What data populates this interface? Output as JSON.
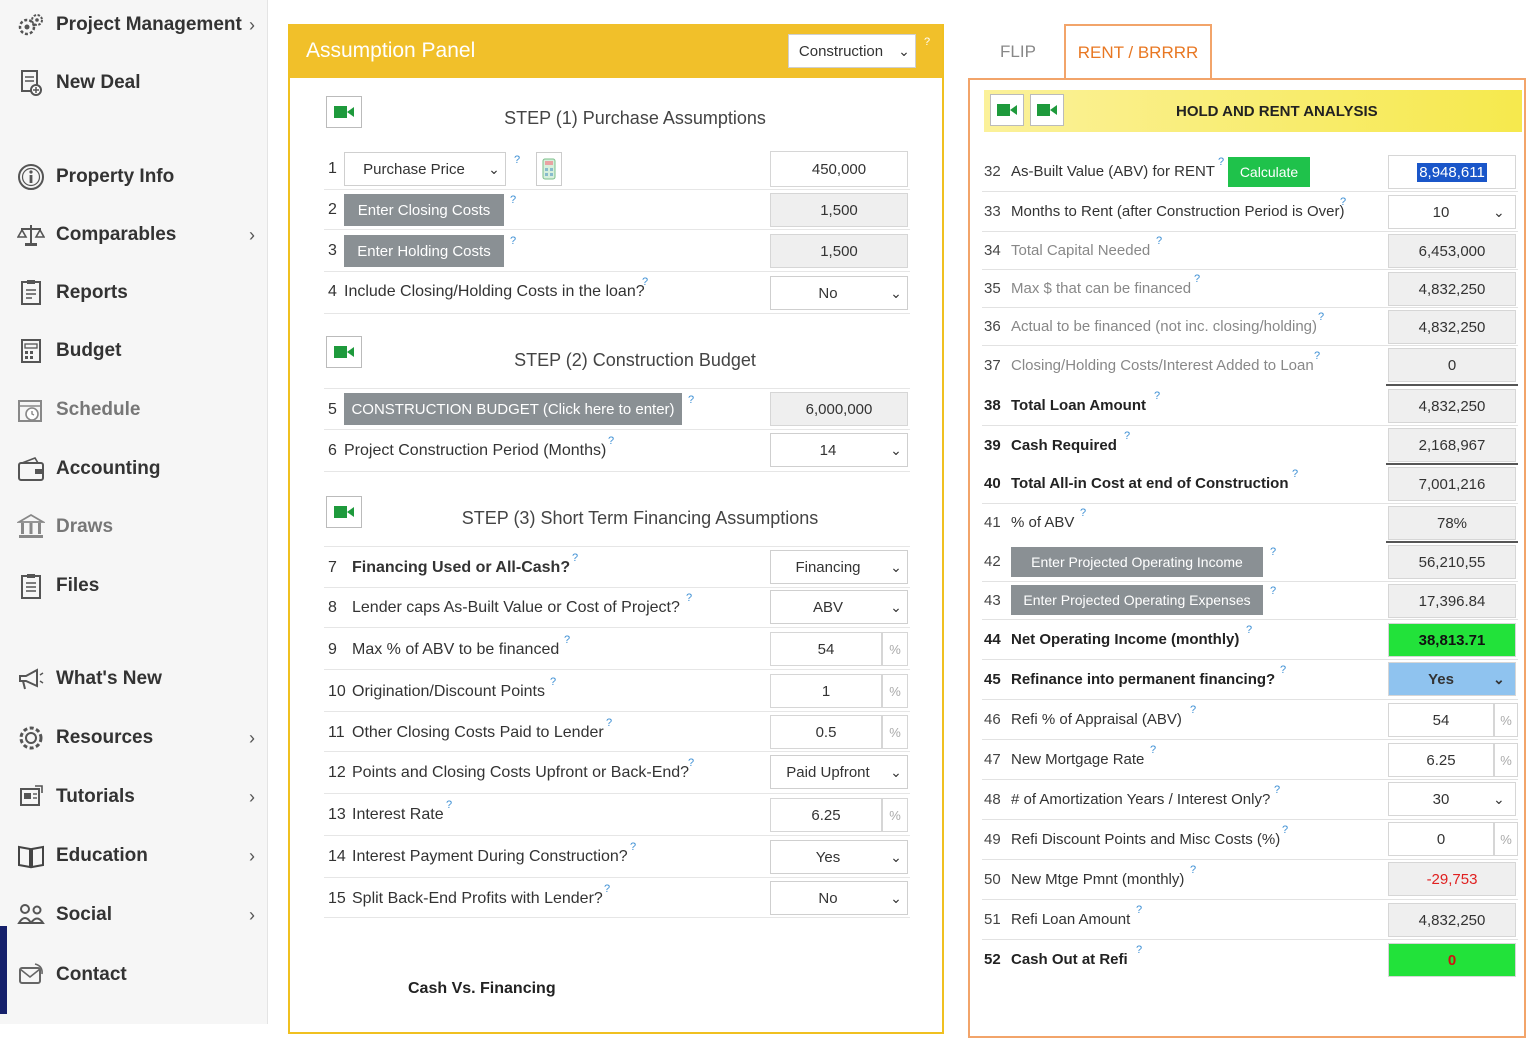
{
  "sidebar": {
    "items": [
      {
        "label": "Project Management",
        "icon": "gears-icon",
        "chevron": true
      },
      {
        "label": "New Deal",
        "icon": "new-document-icon",
        "chevron": false
      },
      {
        "label": "Property Info",
        "icon": "info-icon",
        "chevron": false
      },
      {
        "label": "Comparables",
        "icon": "scales-icon",
        "chevron": true
      },
      {
        "label": "Reports",
        "icon": "report-icon",
        "chevron": false
      },
      {
        "label": "Budget",
        "icon": "budget-icon",
        "chevron": false
      },
      {
        "label": "Schedule",
        "icon": "calendar-clock-icon",
        "chevron": false
      },
      {
        "label": "Accounting",
        "icon": "wallet-icon",
        "chevron": false
      },
      {
        "label": "Draws",
        "icon": "bank-icon",
        "chevron": false
      },
      {
        "label": "Files",
        "icon": "clipboard-icon",
        "chevron": false
      },
      {
        "label": "What's New",
        "icon": "megaphone-icon",
        "chevron": false
      },
      {
        "label": "Resources",
        "icon": "gear-icon",
        "chevron": true
      },
      {
        "label": "Tutorials",
        "icon": "tutorial-icon",
        "chevron": true
      },
      {
        "label": "Education",
        "icon": "book-icon",
        "chevron": true
      },
      {
        "label": "Social",
        "icon": "social-icon",
        "chevron": true
      },
      {
        "label": "Contact",
        "icon": "contact-icon",
        "chevron": false
      }
    ]
  },
  "assumption": {
    "title": "Assumption Panel",
    "mode": "Construction",
    "help": "?",
    "step1_title": "STEP (1) Purchase Assumptions",
    "step2_title": "STEP (2) Construction Budget",
    "step3_title": "STEP (3) Short Term Financing Assumptions",
    "rows": [
      {
        "num": "1",
        "select": "Purchase Price",
        "value": "450,000"
      },
      {
        "num": "2",
        "button": "Enter Closing Costs",
        "value": "1,500"
      },
      {
        "num": "3",
        "button": "Enter Holding Costs",
        "value": "1,500"
      },
      {
        "num": "4",
        "label": "Include Closing/Holding Costs in the loan?",
        "value": "No"
      },
      {
        "num": "5",
        "button": "CONSTRUCTION BUDGET (Click here to enter)",
        "value": "6,000,000"
      },
      {
        "num": "6",
        "label": "Project Construction Period (Months)",
        "value": "14"
      },
      {
        "num": "7",
        "label": "Financing Used or All-Cash?",
        "value": "Financing"
      },
      {
        "num": "8",
        "label": "Lender caps As-Built Value or Cost of Project?",
        "value": "ABV"
      },
      {
        "num": "9",
        "label": "Max % of ABV to be financed",
        "value": "54"
      },
      {
        "num": "10",
        "label": "Origination/Discount Points",
        "value": "1"
      },
      {
        "num": "11",
        "label": "Other Closing Costs Paid to Lender",
        "value": "0.5"
      },
      {
        "num": "12",
        "label": "Points and Closing Costs Upfront or Back-End?",
        "value": "Paid Upfront"
      },
      {
        "num": "13",
        "label": "Interest Rate",
        "value": "6.25"
      },
      {
        "num": "14",
        "label": "Interest Payment During Construction?",
        "value": "Yes"
      },
      {
        "num": "15",
        "label": "Split Back-End Profits with Lender?",
        "value": "No"
      }
    ],
    "pct": "%",
    "cash_vs_financing": "Cash Vs. Financing"
  },
  "tabs": {
    "flip": "FLIP",
    "rent": "RENT / BRRRR"
  },
  "rent": {
    "title": "HOLD AND RENT ANALYSIS",
    "calculate": "Calculate",
    "rows": [
      {
        "num": "32",
        "label": "As-Built Value (ABV) for RENT",
        "value": "8,948,611"
      },
      {
        "num": "33",
        "label": "Months to Rent (after Construction Period is Over)",
        "value": "10"
      },
      {
        "num": "34",
        "label": "Total Capital Needed",
        "value": "6,453,000"
      },
      {
        "num": "35",
        "label": "Max $ that can be financed",
        "value": "4,832,250"
      },
      {
        "num": "36",
        "label": "Actual to be financed (not inc. closing/holding)",
        "value": "4,832,250"
      },
      {
        "num": "37",
        "label": "Closing/Holding Costs/Interest Added to Loan",
        "value": "0"
      },
      {
        "num": "38",
        "label": "Total Loan Amount",
        "value": "4,832,250"
      },
      {
        "num": "39",
        "label": "Cash Required",
        "value": "2,168,967"
      },
      {
        "num": "40",
        "label": "Total All-in Cost at end of Construction",
        "value": "7,001,216"
      },
      {
        "num": "41",
        "label": "% of ABV",
        "value": "78%"
      },
      {
        "num": "42",
        "button": "Enter Projected Operating Income",
        "value": "56,210,55"
      },
      {
        "num": "43",
        "button": "Enter Projected Operating Expenses",
        "value": "17,396.84"
      },
      {
        "num": "44",
        "label": "Net Operating Income (monthly)",
        "value": "38,813.71"
      },
      {
        "num": "45",
        "label": "Refinance into permanent financing?",
        "value": "Yes"
      },
      {
        "num": "46",
        "label": "Refi % of Appraisal (ABV)",
        "value": "54"
      },
      {
        "num": "47",
        "label": "New Mortgage Rate",
        "value": "6.25"
      },
      {
        "num": "48",
        "label": "# of Amortization Years / Interest Only?",
        "value": "30"
      },
      {
        "num": "49",
        "label": "Refi Discount Points and Misc Costs (%)",
        "value": "0"
      },
      {
        "num": "50",
        "label": "New Mtge Pmnt (monthly)",
        "value": "-29,753"
      },
      {
        "num": "51",
        "label": "Refi Loan Amount",
        "value": "4,832,250"
      },
      {
        "num": "52",
        "label": "Cash Out at Refi",
        "value": "0"
      }
    ]
  }
}
